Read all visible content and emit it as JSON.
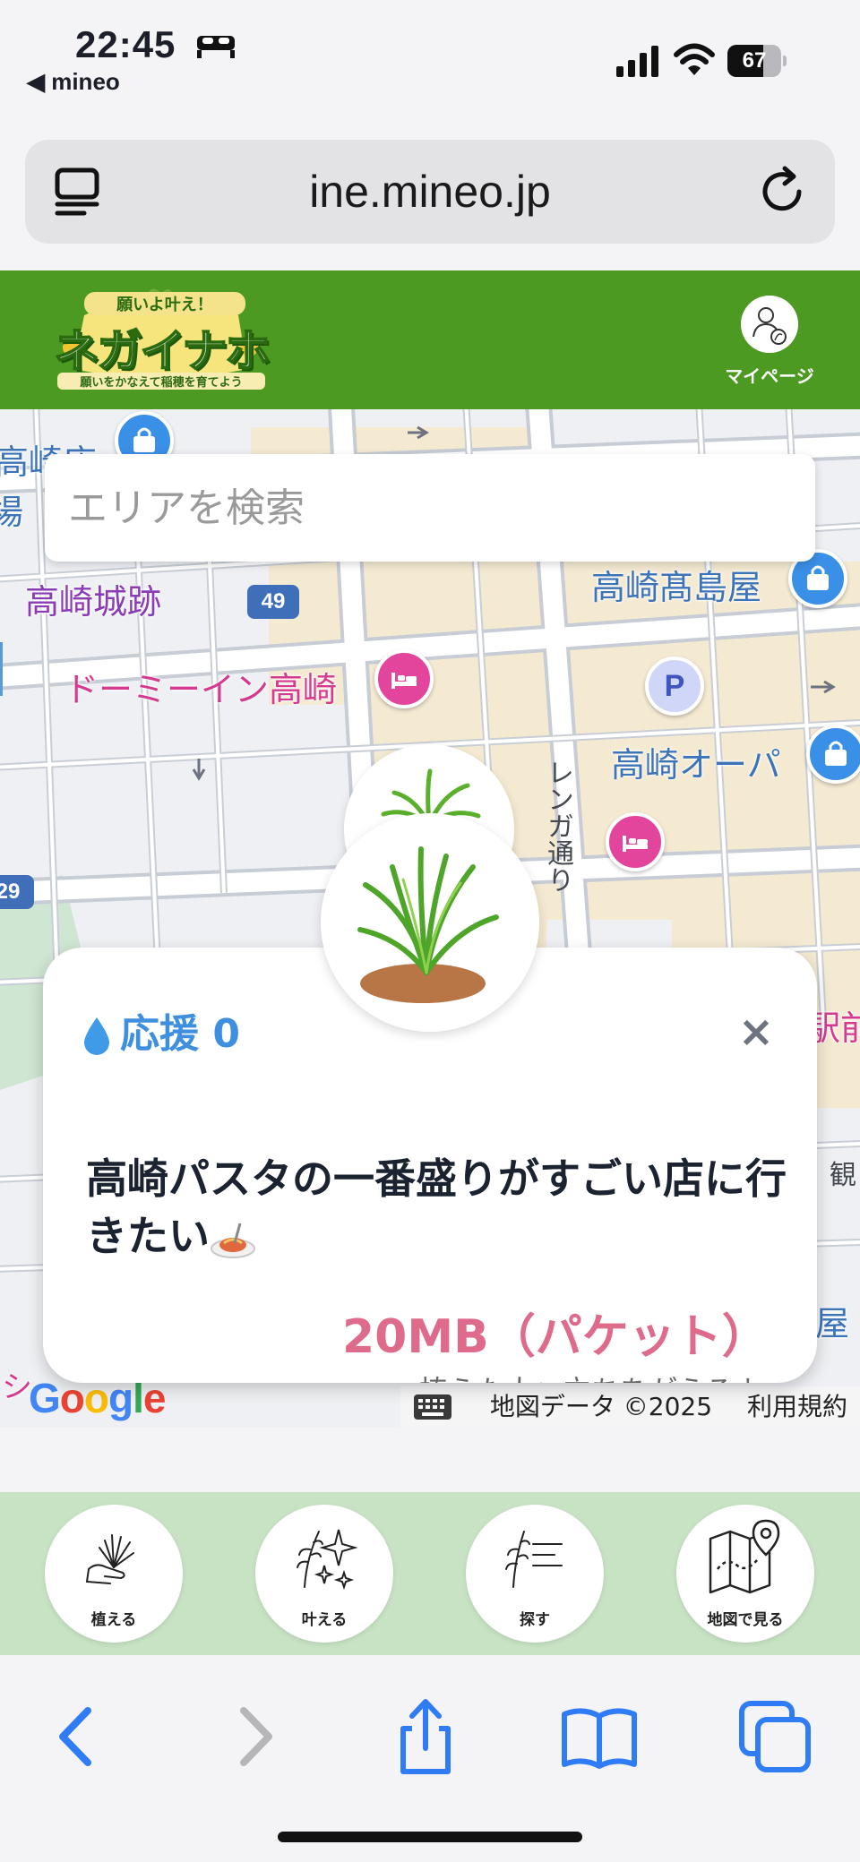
{
  "status_bar": {
    "time": "22:45",
    "back_app": "◀ mineo",
    "battery": "67",
    "battery_level": 0.67
  },
  "browser": {
    "url": "ine.mineo.jp"
  },
  "header": {
    "logo_top": "願いよ叶え！",
    "logo_title": "ネガイナホ",
    "logo_sub": "願いをかなえて稲穂を育てよう",
    "mypage_label": "マイページ"
  },
  "map": {
    "search_placeholder": "エリアを検索",
    "labels": {
      "takasaki_station_cut": "高崎店",
      "takasaki_castle": "高崎城跡",
      "dormy_inn": "ドーミーイン高崎",
      "takashimaya": "高崎髙島屋",
      "opa": "高崎オーパ",
      "renga_dori": "レンガ通り",
      "ekimae_cut": "駅前",
      "kanko_cut": "観",
      "ya_cut": "屋",
      "left_cut": "場",
      "bottom_cut": "シ"
    },
    "route_49": "49",
    "route_29": "29",
    "parking": "P",
    "attribution": {
      "map_data": "地図データ ©2025",
      "terms": "利用規約"
    },
    "google_logo": "Google"
  },
  "card": {
    "support_label": "応援 0",
    "close": "×",
    "wish": "高崎パスタの一番盛りがすごい店に行きたい",
    "reward": "20MB（パケット）",
    "cut_text": "植えた人：立ちをがえるよ"
  },
  "site_nav": [
    {
      "label": "植える",
      "icon": "plant-hand-icon"
    },
    {
      "label": "叶える",
      "icon": "sparkle-rice-icon"
    },
    {
      "label": "探す",
      "icon": "rice-list-icon"
    },
    {
      "label": "地図で見る",
      "icon": "map-pin-icon"
    }
  ],
  "colors": {
    "header_green": "#4d9a23",
    "nav_green": "#c8e3c4",
    "support_blue": "#3f8fe0",
    "reward_pink": "#de6b8c",
    "safari_blue": "#2f7cf6"
  }
}
